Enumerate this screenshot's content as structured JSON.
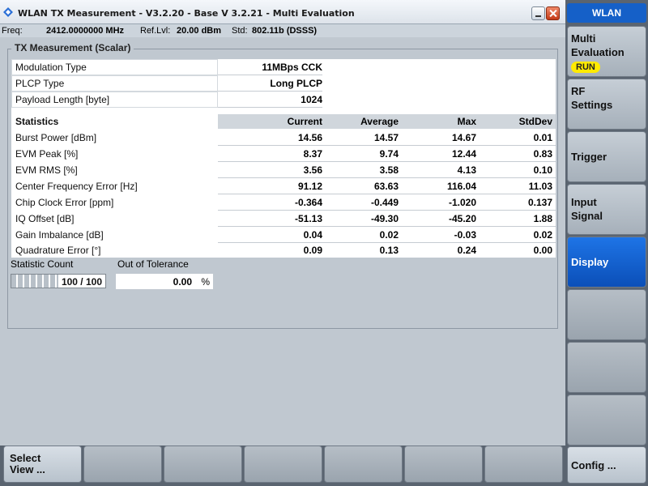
{
  "window": {
    "title": "WLAN TX Measurement  - V3.2.20 - Base V 3.2.21 - Multi Evaluation",
    "logo_icon": "rs-logo-icon"
  },
  "freqbar": {
    "freq_label": "Freq:",
    "freq_value": "2412.0000000 MHz",
    "reflvl_label": "Ref.Lvl:",
    "reflvl_value": "20.00 dBm",
    "std_label": "Std:",
    "std_value": "802.11b (DSSS)"
  },
  "group": {
    "title": "TX Measurement (Scalar)"
  },
  "info_rows": [
    {
      "label": "Modulation Type",
      "value": "11MBps CCK"
    },
    {
      "label": "PLCP Type",
      "value": "Long PLCP"
    },
    {
      "label": "Payload Length [byte]",
      "value": "1024"
    }
  ],
  "stats_header": {
    "label": "Statistics",
    "columns": [
      "Current",
      "Average",
      "Max",
      "StdDev"
    ]
  },
  "stats_rows": [
    {
      "label": "Burst Power [dBm]",
      "values": [
        "14.56",
        "14.57",
        "14.67",
        "0.01"
      ]
    },
    {
      "label": "EVM Peak [%]",
      "values": [
        "8.37",
        "9.74",
        "12.44",
        "0.83"
      ]
    },
    {
      "label": "EVM RMS [%]",
      "values": [
        "3.56",
        "3.58",
        "4.13",
        "0.10"
      ]
    },
    {
      "label": "Center Frequency Error [Hz]",
      "values": [
        "91.12",
        "63.63",
        "116.04",
        "11.03"
      ]
    },
    {
      "label": "Chip Clock Error [ppm]",
      "values": [
        "-0.364",
        "-0.449",
        "-1.020",
        "0.137"
      ]
    },
    {
      "label": "IQ Offset [dB]",
      "values": [
        "-51.13",
        "-49.30",
        "-45.20",
        "1.88"
      ]
    },
    {
      "label": "Gain Imbalance [dB]",
      "values": [
        "0.04",
        "0.02",
        "-0.03",
        "0.02"
      ]
    },
    {
      "label": "Quadrature Error  [°]",
      "values": [
        "0.09",
        "0.13",
        "0.24",
        "0.00"
      ]
    }
  ],
  "statistic_count": {
    "label": "Statistic Count",
    "value": "100 / 100",
    "progress_fraction": 1.0
  },
  "out_of_tolerance": {
    "label": "Out of Tolerance",
    "value": "0.00",
    "unit": "%"
  },
  "right_panel": {
    "header": "WLAN",
    "softkeys": [
      {
        "label": "Multi\nEvaluation",
        "badge": "RUN"
      },
      {
        "label": "RF\nSettings"
      },
      {
        "label": "Trigger"
      },
      {
        "label": "Input\nSignal"
      },
      {
        "label": "Display",
        "active": true
      },
      {
        "label": ""
      },
      {
        "label": ""
      },
      {
        "label": ""
      }
    ]
  },
  "bottom_bar": {
    "softkeys": [
      "Select\nView ...",
      "",
      "",
      "",
      "",
      "",
      ""
    ],
    "config_label": "Config ..."
  },
  "colors": {
    "accent_blue": "#1560c8",
    "run_badge": "#ffea00",
    "background": "#c0c8d0"
  }
}
